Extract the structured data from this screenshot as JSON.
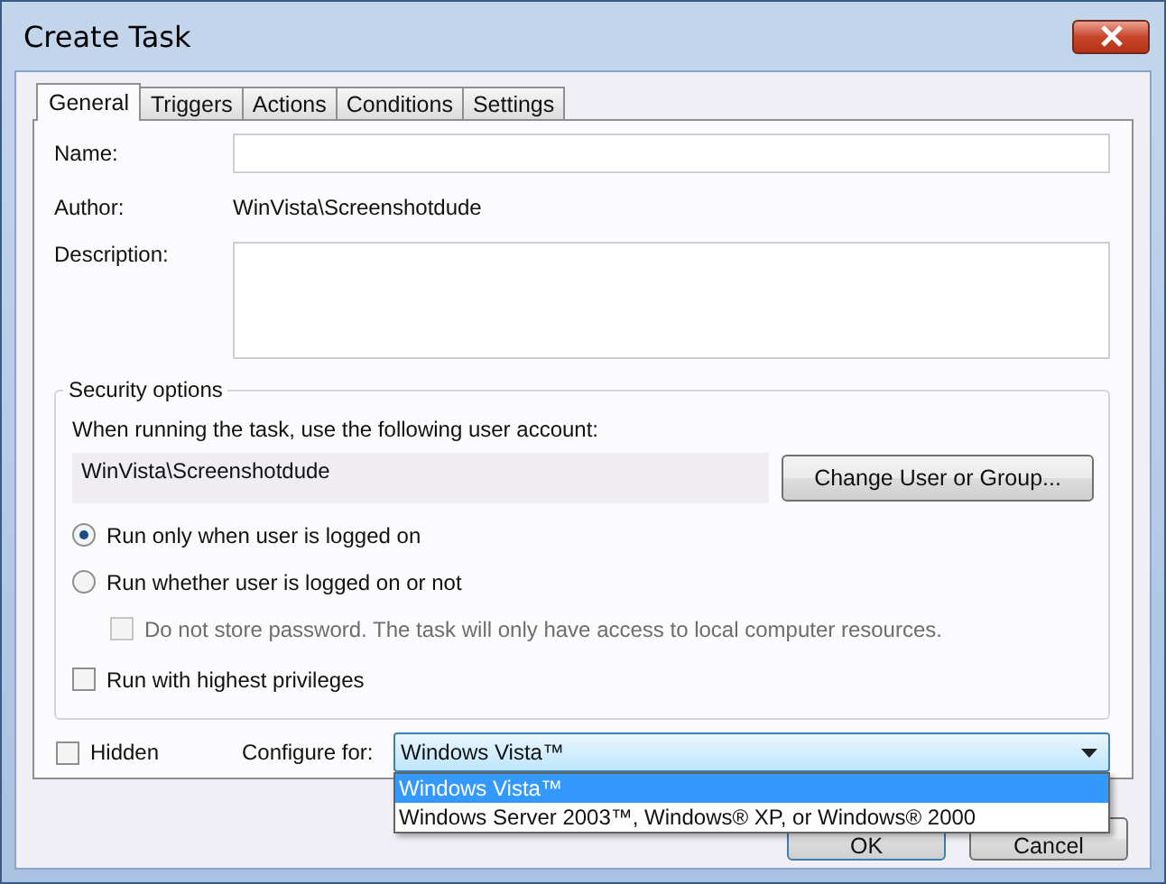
{
  "window": {
    "title": "Create Task"
  },
  "tabs": [
    {
      "label": "General",
      "selected": true
    },
    {
      "label": "Triggers",
      "selected": false
    },
    {
      "label": "Actions",
      "selected": false
    },
    {
      "label": "Conditions",
      "selected": false
    },
    {
      "label": "Settings",
      "selected": false
    }
  ],
  "general": {
    "name_label": "Name:",
    "author_label": "Author:",
    "author_value": "WinVista\\Screenshotdude",
    "description_label": "Description:"
  },
  "security": {
    "legend": "Security options",
    "account_prompt": "When running the task, use the following user account:",
    "account": "WinVista\\Screenshotdude",
    "change_button": "Change User or Group...",
    "options": [
      {
        "kind": "radio",
        "label": "Run only when user is logged on",
        "selected": true
      },
      {
        "kind": "radio",
        "label": "Run whether user is logged on or not",
        "selected": false,
        "children": [
          {
            "kind": "checkbox",
            "label": "Do not store password.  The task will only have access to local computer resources.",
            "checked": false,
            "disabled": true
          }
        ]
      },
      {
        "kind": "checkbox",
        "label": "Run with highest privileges",
        "checked": false,
        "disabled": false
      }
    ]
  },
  "hidden": {
    "label": "Hidden",
    "checked": false
  },
  "configure": {
    "label": "Configure for:",
    "value": "Windows Vista™",
    "expanded": true,
    "options": [
      {
        "label": "Windows Vista™",
        "selected": true
      },
      {
        "label": "Windows Server 2003™, Windows® XP, or Windows® 2000",
        "selected": false
      }
    ]
  },
  "buttons": [
    "OK",
    "Cancel"
  ]
}
